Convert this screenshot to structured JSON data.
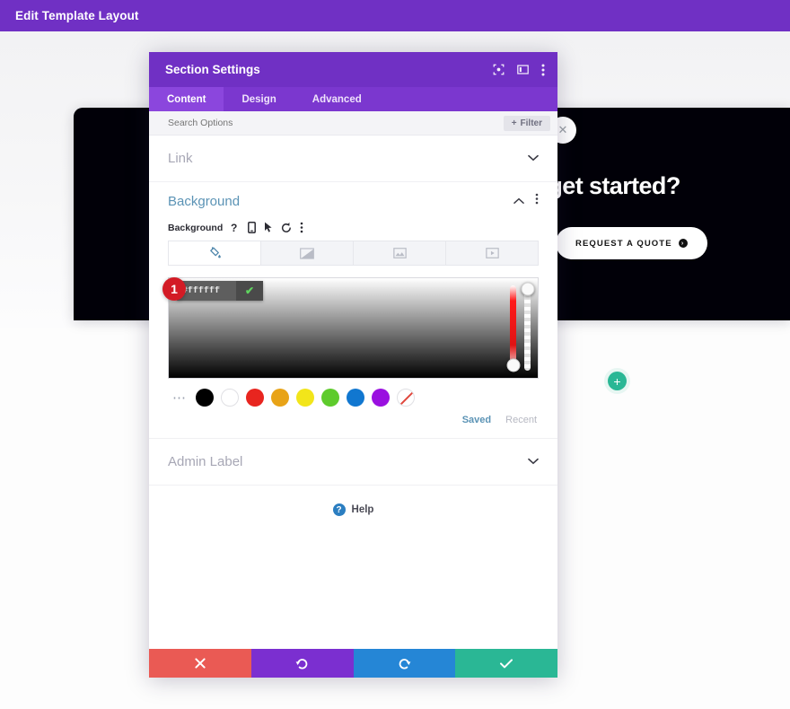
{
  "admin_bar": {
    "title": "Edit Template Layout"
  },
  "page": {
    "hero": {
      "title": "ed to get started?",
      "button_label": "REQUEST A QUOTE",
      "button_badge": "→",
      "background_color": "#010008"
    },
    "close_button_icon": "✕",
    "add_section_icon": "+",
    "add_section_color": "#2ab795"
  },
  "modal": {
    "title": "Section Settings",
    "header_icons": [
      {
        "name": "focus-icon",
        "glyph": "◎"
      },
      {
        "name": "layout-toggle-icon",
        "glyph": "▥"
      },
      {
        "name": "more-options-icon",
        "glyph": "⋮"
      }
    ],
    "tabs": [
      {
        "label": "Content",
        "active": true
      },
      {
        "label": "Design",
        "active": false
      },
      {
        "label": "Advanced",
        "active": false
      }
    ],
    "search": {
      "placeholder": "Search Options",
      "value": "",
      "filter_label": "Filter",
      "filter_icon": "+"
    },
    "sections": {
      "link": {
        "label": "Link",
        "chevron": "⌄",
        "expanded": false
      },
      "background": {
        "label": "Background",
        "collapse_icon": "⌃",
        "more_icon": "⋮",
        "sub_label": "Background",
        "sub_icons": [
          {
            "name": "help-icon",
            "glyph": "?"
          },
          {
            "name": "responsive-icon",
            "glyph": "⎕"
          },
          {
            "name": "hover-cursor-icon",
            "glyph": "➤"
          },
          {
            "name": "reset-icon",
            "glyph": "↺"
          },
          {
            "name": "option-more-icon",
            "glyph": "⋮"
          }
        ],
        "type_tabs": [
          {
            "name": "background-color-tab",
            "glyph": "⬣",
            "active": true
          },
          {
            "name": "background-gradient-tab",
            "glyph": "◢",
            "active": false
          },
          {
            "name": "background-image-tab",
            "glyph": "⛰",
            "active": false
          },
          {
            "name": "background-video-tab",
            "glyph": "▶",
            "active": false
          }
        ],
        "color_picker": {
          "hex_value": "#ffffff",
          "confirm_icon": "✔",
          "step_badge": "1",
          "swatch_more": "⋯",
          "swatches": [
            {
              "name": "swatch-black",
              "color": "#000000"
            },
            {
              "name": "swatch-white",
              "color": "#ffffff"
            },
            {
              "name": "swatch-red",
              "color": "#e8251f"
            },
            {
              "name": "swatch-orange",
              "color": "#e8a317"
            },
            {
              "name": "swatch-yellow",
              "color": "#f2e51a"
            },
            {
              "name": "swatch-green",
              "color": "#5ecb2c"
            },
            {
              "name": "swatch-blue",
              "color": "#1177d0"
            },
            {
              "name": "swatch-purple",
              "color": "#9a10e0"
            },
            {
              "name": "swatch-none",
              "color": "none"
            }
          ],
          "palette_tabs": [
            {
              "label": "Saved",
              "active": true
            },
            {
              "label": "Recent",
              "active": false
            }
          ]
        }
      },
      "admin_label": {
        "label": "Admin Label",
        "chevron": "⌄",
        "expanded": false
      }
    },
    "help": {
      "icon": "?",
      "label": "Help"
    },
    "actions": [
      {
        "name": "cancel-button",
        "glyph": "✕",
        "color": "#ea5a54"
      },
      {
        "name": "undo-button",
        "glyph": "↺",
        "color": "#7b2fd0"
      },
      {
        "name": "redo-button",
        "glyph": "↻",
        "color": "#2586d6"
      },
      {
        "name": "save-button",
        "glyph": "✔",
        "color": "#2ab795"
      }
    ]
  }
}
